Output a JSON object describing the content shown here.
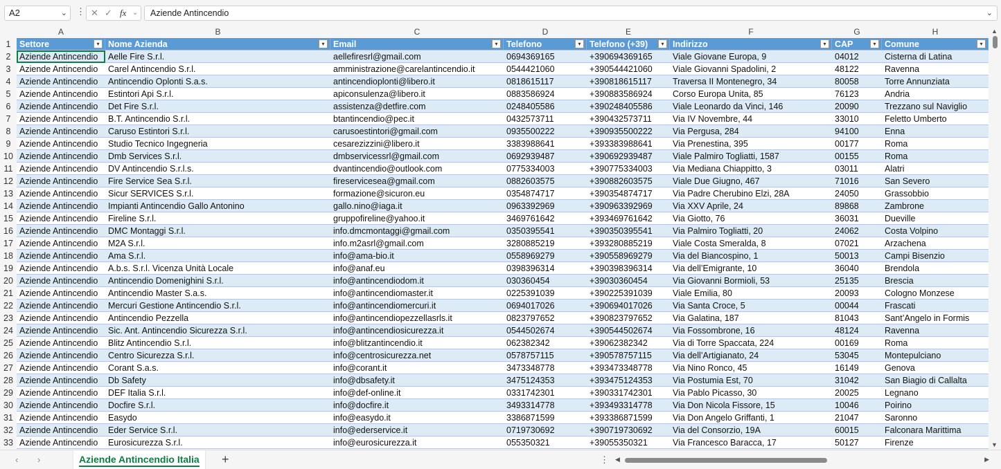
{
  "namebox": {
    "value": "A2"
  },
  "formula": {
    "fx_label": "fx",
    "value": "Aziende Antincendio"
  },
  "columns": [
    "A",
    "B",
    "C",
    "D",
    "E",
    "F",
    "G",
    "H"
  ],
  "headers": [
    "Settore",
    "Nome Azienda",
    "Email",
    "Telefono",
    "Telefono (+39)",
    "Indirizzo",
    "CAP",
    "Comune"
  ],
  "row_numbers": [
    "1",
    "2",
    "3",
    "4",
    "5",
    "6",
    "7",
    "8",
    "9",
    "10",
    "11",
    "12",
    "13",
    "14",
    "15",
    "16",
    "17",
    "18",
    "19",
    "20",
    "21",
    "22",
    "23",
    "24",
    "25",
    "26",
    "27",
    "28",
    "29",
    "30",
    "31",
    "32",
    "33"
  ],
  "rows": [
    [
      "Aziende Antincendio",
      "Aelle Fire S.r.l.",
      "aellefiresrl@gmail.com",
      "0694369165",
      "+390694369165",
      "Viale Giovane Europa, 9",
      "04012",
      "Cisterna di Latina"
    ],
    [
      "Aziende Antincendio",
      "Carel Antincendio S.r.l.",
      "amministrazione@carelantincendio.it",
      "0544421060",
      "+390544421060",
      "Viale Giovanni Spadolini, 2",
      "48122",
      "Ravenna"
    ],
    [
      "Aziende Antincendio",
      "Antincendio Oplonti S.a.s.",
      "antincendioplonti@libero.it",
      "0818615117",
      "+390818615117",
      "Traversa II Montenegro, 34",
      "80058",
      "Torre Annunziata"
    ],
    [
      "Aziende Antincendio",
      "Estintori Api S.r.l.",
      "apiconsulenza@libero.it",
      "0883586924",
      "+390883586924",
      "Corso Europa Unita, 85",
      "76123",
      "Andria"
    ],
    [
      "Aziende Antincendio",
      "Det Fire S.r.l.",
      "assistenza@detfire.com",
      "0248405586",
      "+390248405586",
      "Viale Leonardo da Vinci, 146",
      "20090",
      "Trezzano sul Naviglio"
    ],
    [
      "Aziende Antincendio",
      "B.T. Antincendio S.r.l.",
      "btantincendio@pec.it",
      "0432573711",
      "+390432573711",
      "Via IV Novembre, 44",
      "33010",
      "Feletto Umberto"
    ],
    [
      "Aziende Antincendio",
      "Caruso Estintori S.r.l.",
      "carusoestintori@gmail.com",
      "0935500222",
      "+390935500222",
      "Via Pergusa, 284",
      "94100",
      "Enna"
    ],
    [
      "Aziende Antincendio",
      "Studio Tecnico Ingegneria",
      "cesarezizzini@libero.it",
      "3383988641",
      "+393383988641",
      "Via Prenestina, 395",
      "00177",
      "Roma"
    ],
    [
      "Aziende Antincendio",
      "Dmb Services S.r.l.",
      "dmbservicessrl@gmail.com",
      "0692939487",
      "+390692939487",
      "Viale Palmiro Togliatti, 1587",
      "00155",
      "Roma"
    ],
    [
      "Aziende Antincendio",
      "DV Antincendio S.r.l.s.",
      "dvantincendio@outlook.com",
      "0775334003",
      "+390775334003",
      "Via Mediana Chiappitto, 3",
      "03011",
      "Alatri"
    ],
    [
      "Aziende Antincendio",
      "Fire Service Sea S.r.l.",
      "fireservicesea@gmail.com",
      "0882603575",
      "+390882603575",
      "Viale Due Giugno, 467",
      "71016",
      "San Severo"
    ],
    [
      "Aziende Antincendio",
      "Sicur SERVICES S.r.l.",
      "formazione@sicuron.eu",
      "0354874717",
      "+390354874717",
      "Via Padre Cherubino Elzi, 28A",
      "24050",
      "Grassobbio"
    ],
    [
      "Aziende Antincendio",
      "Impianti Antincendio Gallo Antonino",
      "gallo.nino@iaga.it",
      "0963392969",
      "+390963392969",
      "Via XXV Aprile, 24",
      "89868",
      "Zambrone"
    ],
    [
      "Aziende Antincendio",
      "Fireline S.r.l.",
      "gruppofireline@yahoo.it",
      "3469761642",
      "+393469761642",
      "Via Giotto, 76",
      "36031",
      "Dueville"
    ],
    [
      "Aziende Antincendio",
      "DMC Montaggi S.r.l.",
      "info.dmcmontaggi@gmail.com",
      "0350395541",
      "+390350395541",
      "Via Palmiro Togliatti, 20",
      "24062",
      "Costa Volpino"
    ],
    [
      "Aziende Antincendio",
      "M2A S.r.l.",
      "info.m2asrl@gmail.com",
      "3280885219",
      "+393280885219",
      "Viale Costa Smeralda, 8",
      "07021",
      "Arzachena"
    ],
    [
      "Aziende Antincendio",
      "Ama S.r.l.",
      "info@ama-bio.it",
      "0558969279",
      "+390558969279",
      "Via del Biancospino, 1",
      "50013",
      "Campi Bisenzio"
    ],
    [
      "Aziende Antincendio",
      "A.b.s. S.r.l. Vicenza Unità Locale",
      "info@anaf.eu",
      "0398396314",
      "+390398396314",
      "Via dell’Emigrante, 10",
      "36040",
      "Brendola"
    ],
    [
      "Aziende Antincendio",
      "Antincendio Domenighini S.r.l.",
      "info@antincendiodom.it",
      "030360454",
      "+39030360454",
      "Via Giovanni Bormioli, 53",
      "25135",
      "Brescia"
    ],
    [
      "Aziende Antincendio",
      "Antincendio Master S.a.s.",
      "info@antincendiomaster.it",
      "0225391039",
      "+390225391039",
      "Viale Emilia, 80",
      "20093",
      "Cologno Monzese"
    ],
    [
      "Aziende Antincendio",
      "Mercuri Gestione Antincendio S.r.l.",
      "info@antincendiomercuri.it",
      "0694017026",
      "+390694017026",
      "Via Santa Croce, 5",
      "00044",
      "Frascati"
    ],
    [
      "Aziende Antincendio",
      "Antincendio Pezzella",
      "info@antincendiopezzellasrls.it",
      "0823797652",
      "+390823797652",
      "Via Galatina, 187",
      "81043",
      "Sant’Angelo in Formis"
    ],
    [
      "Aziende Antincendio",
      "Sic. Ant. Antincendio Sicurezza S.r.l.",
      "info@antincendiosicurezza.it",
      "0544502674",
      "+390544502674",
      "Via Fossombrone, 16",
      "48124",
      "Ravenna"
    ],
    [
      "Aziende Antincendio",
      "Blitz Antincendio S.r.l.",
      "info@blitzantincendio.it",
      "062382342",
      "+39062382342",
      "Via di Torre Spaccata, 224",
      "00169",
      "Roma"
    ],
    [
      "Aziende Antincendio",
      "Centro Sicurezza S.r.l.",
      "info@centrosicurezza.net",
      "0578757115",
      "+390578757115",
      "Via dell’Artigianato, 24",
      "53045",
      "Montepulciano"
    ],
    [
      "Aziende Antincendio",
      "Corant S.a.s.",
      "info@corant.it",
      "3473348778",
      "+393473348778",
      "Via Nino Ronco, 45",
      "16149",
      "Genova"
    ],
    [
      "Aziende Antincendio",
      "Db Safety",
      "info@dbsafety.it",
      "3475124353",
      "+393475124353",
      "Via Postumia Est, 70",
      "31042",
      "San Biagio di Callalta"
    ],
    [
      "Aziende Antincendio",
      "DEF Italia S.r.l.",
      "info@def-online.it",
      "0331742301",
      "+390331742301",
      "Via Pablo Picasso, 30",
      "20025",
      "Legnano"
    ],
    [
      "Aziende Antincendio",
      "Docfire S.r.l.",
      "info@docfire.it",
      "3493314778",
      "+393493314778",
      "Via Don Nicola Fissore, 15",
      "10046",
      "Poirino"
    ],
    [
      "Aziende Antincendio",
      "Easydo",
      "info@easydo.it",
      "3386871599",
      "+393386871599",
      "Via Don Angelo Griffanti, 1",
      "21047",
      "Saronno"
    ],
    [
      "Aziende Antincendio",
      "Eder Service S.r.l.",
      "info@ederservice.it",
      "0719730692",
      "+390719730692",
      "Via del Consorzio, 19A",
      "60015",
      "Falconara Marittima"
    ],
    [
      "Aziende Antincendio",
      "Eurosicurezza S.r.l.",
      "info@eurosicurezza.it",
      "055350321",
      "+39055350321",
      "Via Francesco Baracca, 17",
      "50127",
      "Firenze"
    ]
  ],
  "sheet_tabs": [
    "Aziende Antincendio Italia"
  ],
  "icons": {
    "prev_sheet": "chevron-left-icon",
    "next_sheet": "chevron-right-icon",
    "add_sheet": "plus-icon",
    "filter": "filter-dropdown-icon"
  },
  "colors": {
    "header_fill": "#5b9bd5",
    "band_fill": "#ddebf7",
    "accent": "#107c41"
  }
}
